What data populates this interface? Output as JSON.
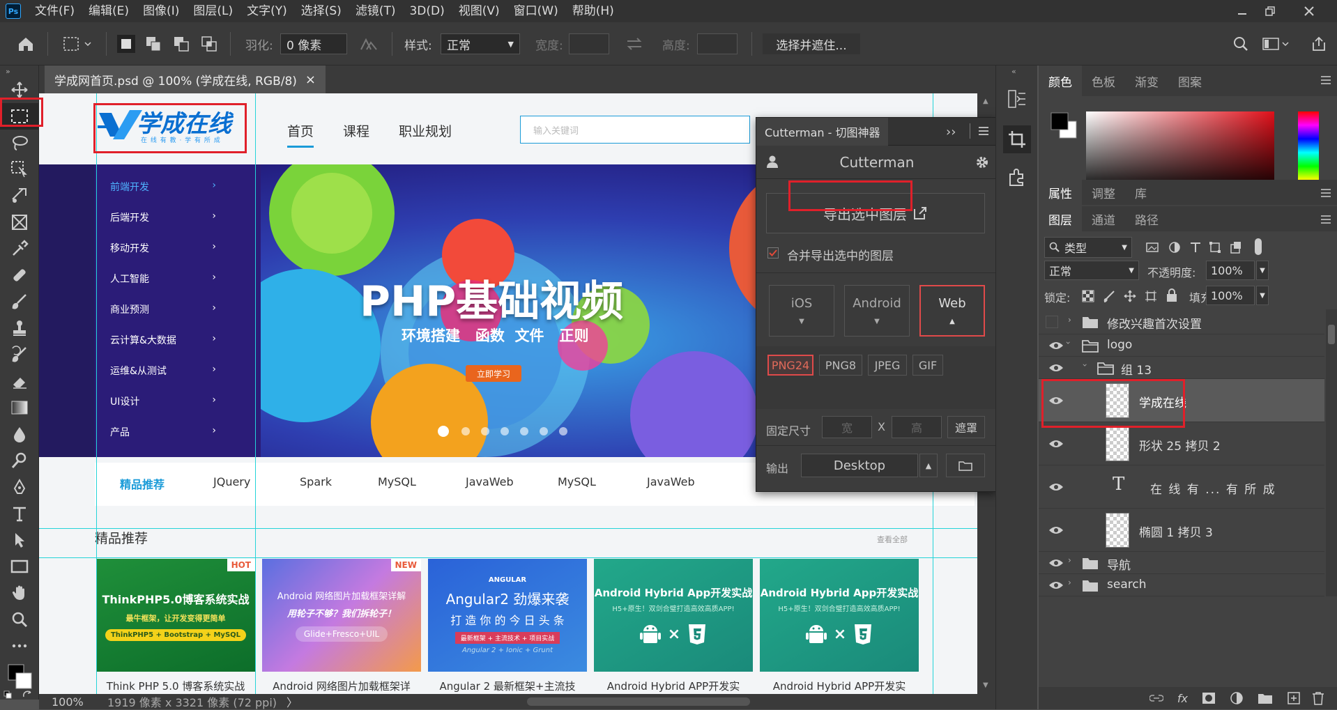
{
  "menubar": {
    "logo": "Ps",
    "items": [
      "文件(F)",
      "编辑(E)",
      "图像(I)",
      "图层(L)",
      "文字(Y)",
      "选择(S)",
      "滤镜(T)",
      "3D(D)",
      "视图(V)",
      "窗口(W)",
      "帮助(H)"
    ]
  },
  "options": {
    "feather_label": "羽化:",
    "feather_value": "0 像素",
    "style_label": "样式:",
    "style_value": "正常",
    "width_label": "宽度:",
    "height_label": "高度:",
    "select_mask": "选择并遮住..."
  },
  "document": {
    "tab_title": "学成网首页.psd @ 100% (学成在线, RGB/8)",
    "close": "×"
  },
  "status": {
    "zoom": "100%",
    "info": "1919 像素 x 3321 像素 (72 ppi)",
    "arrow": "〉"
  },
  "site": {
    "logo_text": "学成在线",
    "logo_sub": "在 线 有 教 · 学 有 所 成",
    "nav": [
      "首页",
      "课程",
      "职业规划"
    ],
    "search_placeholder": "输入关键词",
    "sidebar": [
      "前端开发",
      "后端开发",
      "移动开发",
      "人工智能",
      "商业预测",
      "云计算&大数据",
      "运维&从测试",
      "UI设计",
      "产品"
    ],
    "banner_title": "PHP基础视频",
    "banner_sub": "环境搭建   函数  文件   正则",
    "banner_btn": "立即学习",
    "tags": [
      "精品推荐",
      "JQuery",
      "Spark",
      "MySQL",
      "JavaWeb",
      "MySQL",
      "JavaWeb"
    ],
    "section_title": "精品推荐",
    "section_more": "查看全部",
    "courses": [
      {
        "badge": "HOT",
        "title": "ThinkPHP5.0博客系统实战",
        "sub": "最牛框架，让开发变得更简单",
        "chip": "ThinkPHP5 + Bootstrap + MySQL",
        "caption": "Think PHP 5.0 博客系统实战"
      },
      {
        "badge": "NEW",
        "title": "Android 网络图片加载框架详解",
        "sub": "用轮子不够？我们拆轮子！",
        "chip": "Glide+Fresco+UIL",
        "caption": "Android 网络图片加载框架详"
      },
      {
        "badge": "ANGULAR",
        "title": "Angular2 劲爆来袭",
        "sub": "打 造 你 的 今 日 头 条",
        "chip": "最新框架 + 主流技术 + 项目实战",
        "chip2": "Angular 2 + Ionic + Grunt",
        "caption": "Angular 2 最新框架+主流技"
      },
      {
        "badge": "",
        "title": "Android Hybrid App开发实战",
        "sub": "H5+原生！双剑合璧打造高效高质APP!",
        "chip": "×",
        "caption": "Android Hybrid APP开发实"
      },
      {
        "badge": "",
        "title": "Android Hybrid App开发实战",
        "sub": "H5+原生！双剑合璧打造高效高质APP!",
        "chip": "×",
        "caption": "Android Hybrid APP开发实"
      }
    ]
  },
  "cutterman": {
    "title": "Cutterman - 切图神器",
    "expand": "››",
    "name": "Cutterman",
    "export_btn": "导出选中图层",
    "merge_label": "合并导出选中的图层",
    "platforms": [
      "iOS",
      "Android",
      "Web"
    ],
    "formats": [
      "PNG24",
      "PNG8",
      "JPEG",
      "GIF"
    ],
    "fixed_label": "固定尺寸",
    "w_placeholder": "宽",
    "x_label": "X",
    "h_placeholder": "高",
    "mask_btn": "遮罩",
    "output_label": "输出",
    "output_value": "Desktop"
  },
  "color_panel": {
    "tabs": [
      "颜色",
      "色板",
      "渐变",
      "图案"
    ]
  },
  "props_panel": {
    "tabs": [
      "属性",
      "调整",
      "库"
    ]
  },
  "layers_panel": {
    "tabs": [
      "图层",
      "通道",
      "路径"
    ],
    "filter_kind": "类型",
    "blend_mode": "正常",
    "opacity_label": "不透明度:",
    "opacity_value": "100%",
    "lock_label": "锁定:",
    "fill_label": "填充:",
    "fill_value": "100%",
    "layers": [
      {
        "name": "修改兴趣首次设置",
        "type": "group",
        "visible": false
      },
      {
        "name": "logo",
        "type": "group",
        "visible": true
      },
      {
        "name": "组 13",
        "type": "group",
        "visible": true
      },
      {
        "name": "学成在线",
        "type": "shape",
        "visible": true,
        "selected": true
      },
      {
        "name": "形状 25 拷贝 2",
        "type": "shape",
        "visible": true
      },
      {
        "name": "在 线 有 ... 有 所 成",
        "type": "text",
        "visible": true
      },
      {
        "name": "椭圆 1 拷贝 3",
        "type": "shape",
        "visible": true
      },
      {
        "name": "导航",
        "type": "group",
        "visible": true
      },
      {
        "name": "search",
        "type": "group",
        "visible": true
      }
    ],
    "text_glyph": "T"
  }
}
